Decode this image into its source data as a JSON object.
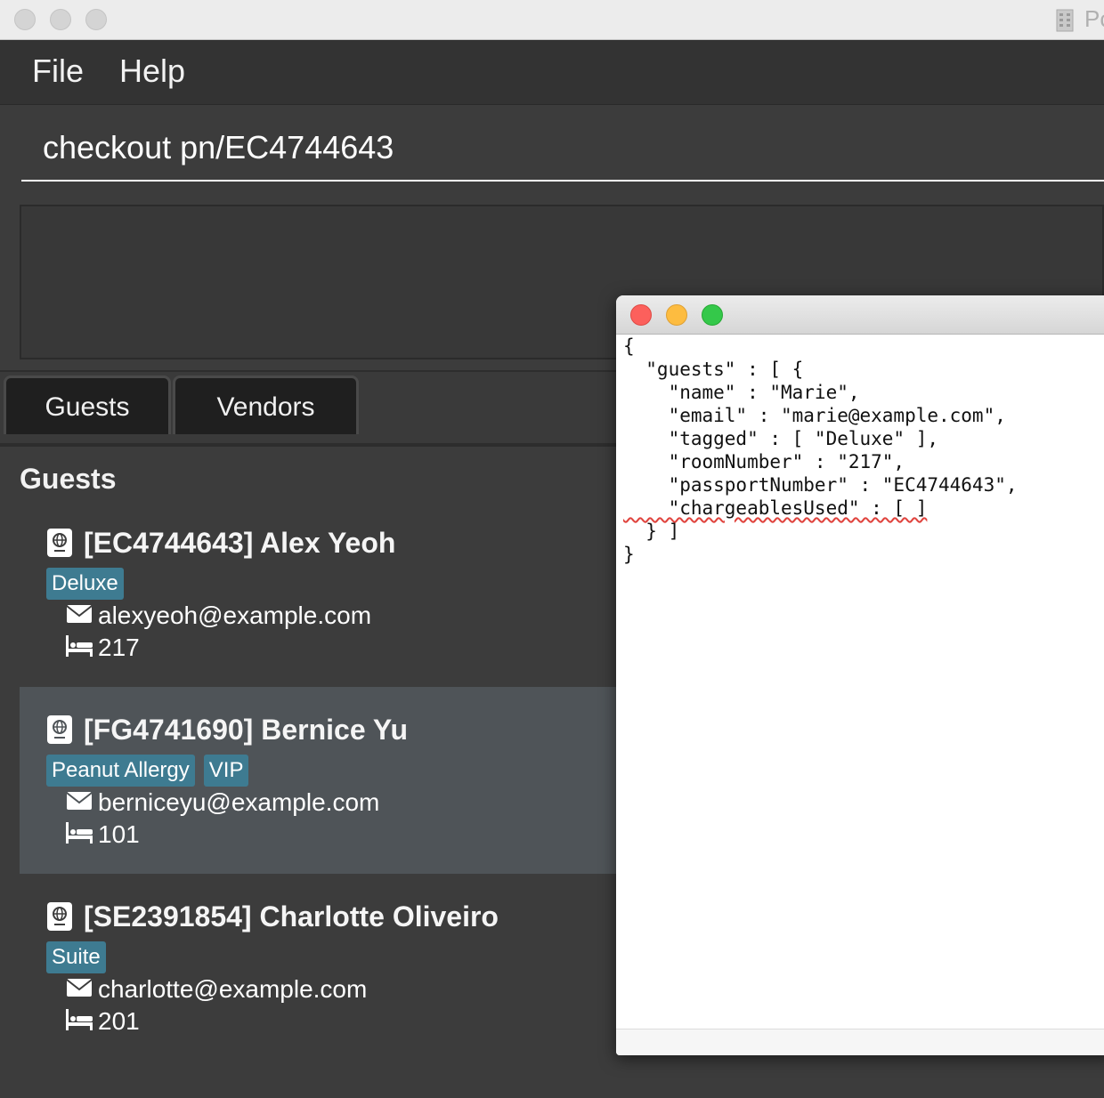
{
  "window": {
    "title_fragment": "Pc"
  },
  "menu": {
    "file": "File",
    "help": "Help"
  },
  "command_box": {
    "value": "checkout pn/EC4744643"
  },
  "result_display": {
    "text": ""
  },
  "tabs": [
    {
      "label": "Guests"
    },
    {
      "label": "Vendors"
    }
  ],
  "section_title": "Guests",
  "guests": [
    {
      "id_name": "[EC4744643] Alex Yeoh",
      "tags": [
        "Deluxe"
      ],
      "email": "alexyeoh@example.com",
      "room": "217"
    },
    {
      "id_name": "[FG4741690] Bernice Yu",
      "tags": [
        "Peanut Allergy",
        "VIP"
      ],
      "email": "berniceyu@example.com",
      "room": "101"
    },
    {
      "id_name": "[SE2391854] Charlotte Oliveiro",
      "tags": [
        "Suite"
      ],
      "email": "charlotte@example.com",
      "room": "201"
    }
  ],
  "colors": {
    "tag": "#3e7b91",
    "card_selected": "#4f5458",
    "card": "#3c3c3c",
    "background": "#3c3c3c"
  },
  "editor": {
    "lines": [
      "{",
      "  \"guests\" : [ {",
      "    \"name\" : \"Marie\",",
      "    \"email\" : \"marie@example.com\",",
      "    \"tagged\" : [ \"Deluxe\" ],",
      "    \"roomNumber\" : \"217\",",
      "    \"passportNumber\" : \"EC4744643\",",
      "    \"chargeablesUsed\" : [ ]",
      "  } ]",
      "}"
    ]
  }
}
